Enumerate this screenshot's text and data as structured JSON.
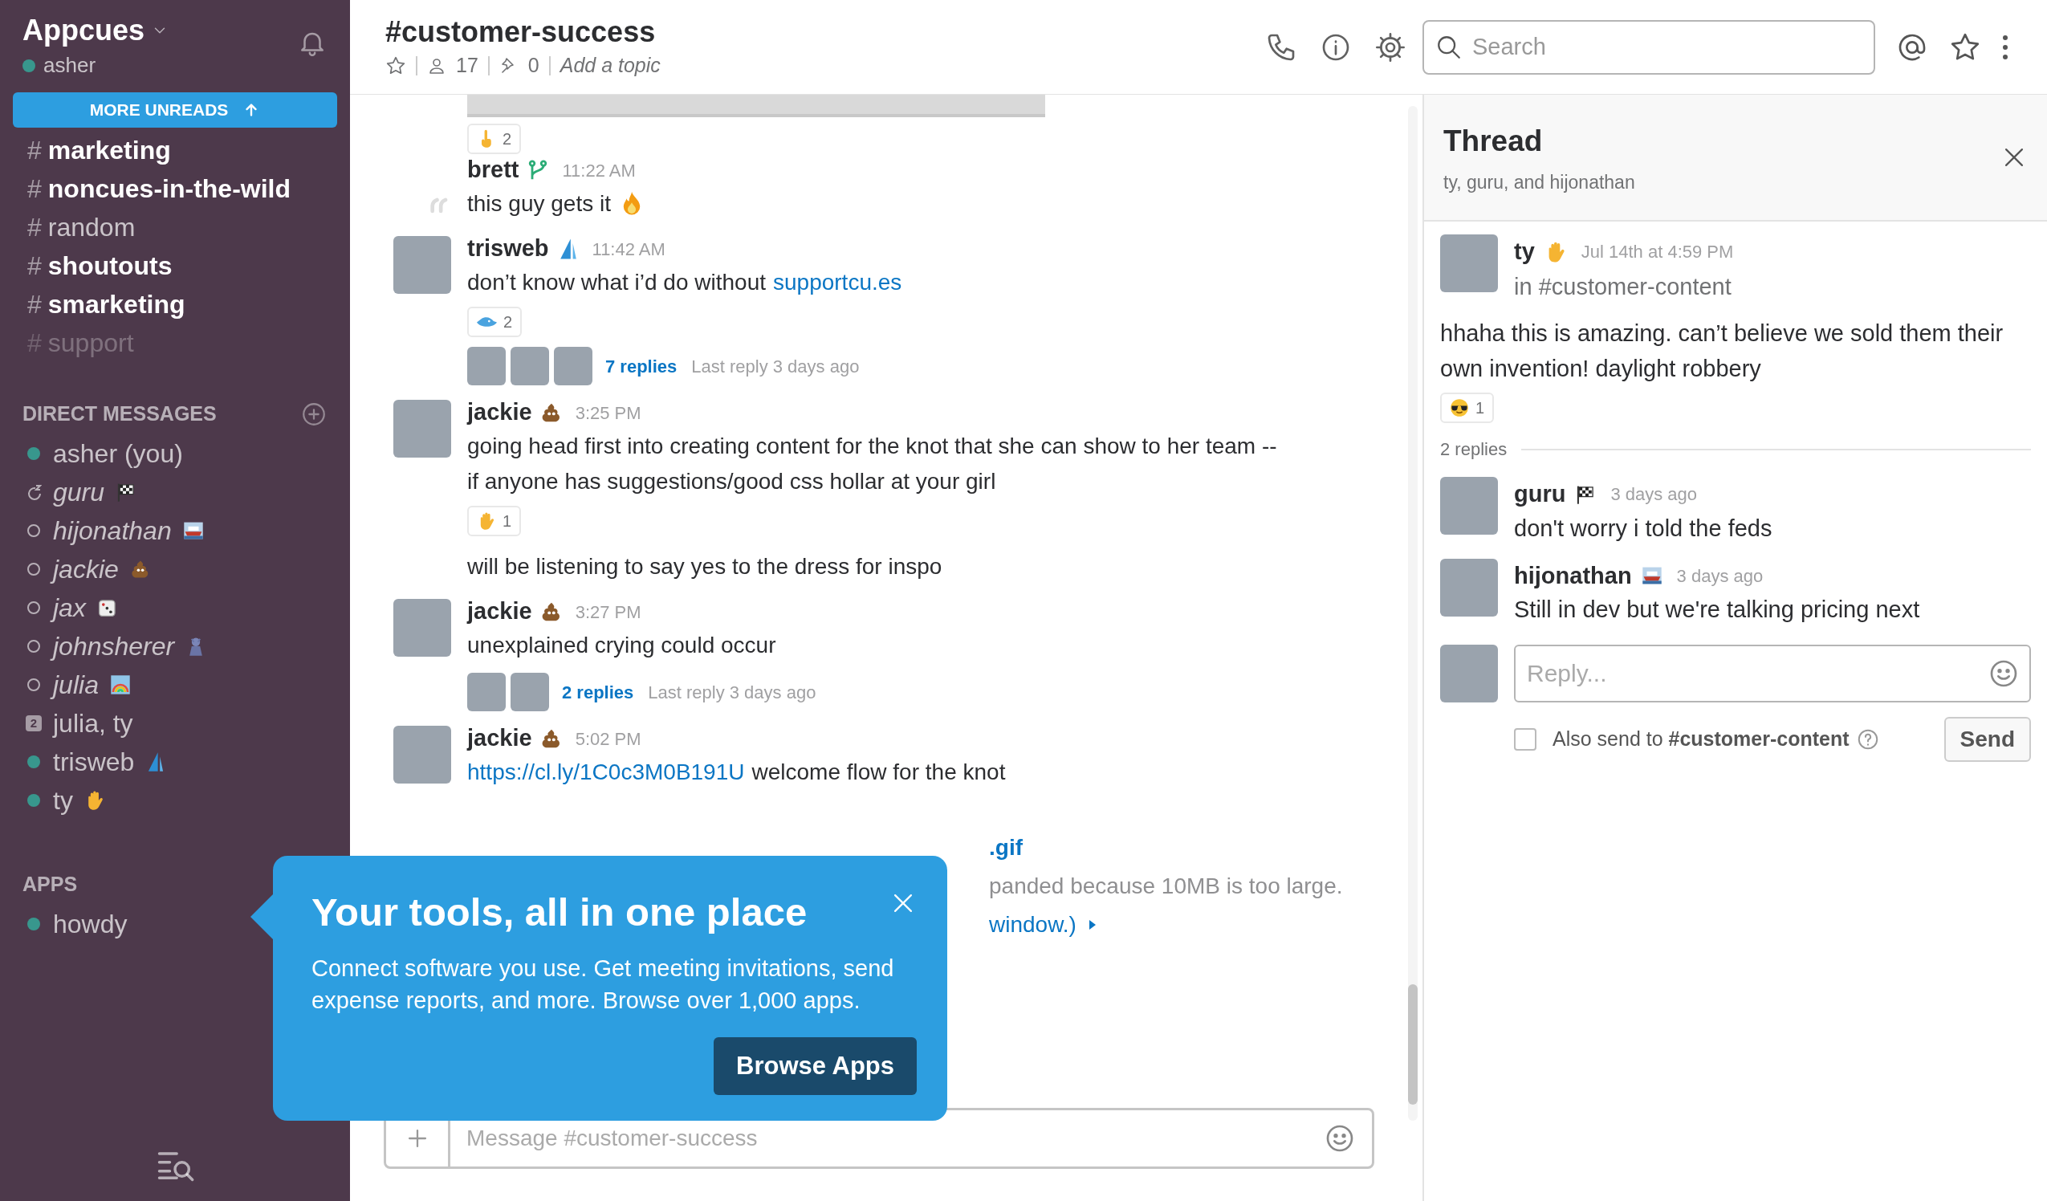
{
  "sidebar": {
    "team": "Appcues",
    "user": "asher",
    "user_online": true,
    "more_unreads": "MORE UNREADS",
    "channels": [
      {
        "prefix": "#",
        "name": "marketing",
        "unread": true,
        "muted": false
      },
      {
        "prefix": "#",
        "name": "noncues-in-the-wild",
        "unread": true,
        "muted": false
      },
      {
        "prefix": "#",
        "name": "random",
        "unread": false,
        "muted": false
      },
      {
        "prefix": "#",
        "name": "shoutouts",
        "unread": true,
        "muted": false
      },
      {
        "prefix": "#",
        "name": "smarketing",
        "unread": true,
        "muted": false
      },
      {
        "prefix": "#",
        "name": "support",
        "unread": false,
        "muted": true
      }
    ],
    "dm_header": "DIRECT MESSAGES",
    "direct_messages": [
      {
        "name": "asher (you)",
        "kind": "online"
      },
      {
        "name": "guru",
        "kind": "snoozed",
        "emoji": {
          "kind": "checkered-flag"
        }
      },
      {
        "name": "hijonathan",
        "kind": "away",
        "emoji": {
          "kind": "ship"
        }
      },
      {
        "name": "jackie",
        "kind": "away",
        "emoji": {
          "kind": "poop"
        }
      },
      {
        "name": "jax",
        "kind": "away",
        "emoji": {
          "kind": "die"
        }
      },
      {
        "name": "johnsherer",
        "kind": "away",
        "emoji": {
          "kind": "figure"
        }
      },
      {
        "name": "julia",
        "kind": "away",
        "emoji": {
          "kind": "rainbow"
        }
      },
      {
        "name": "julia, ty",
        "kind": "group",
        "badge": "2"
      },
      {
        "name": "trisweb",
        "kind": "online",
        "emoji": {
          "kind": "sail"
        }
      },
      {
        "name": "ty",
        "kind": "online",
        "emoji": {
          "kind": "hand"
        }
      }
    ],
    "apps_header": "APPS",
    "apps": [
      {
        "name": "howdy",
        "kind": "online"
      }
    ]
  },
  "channel_header": {
    "title": "#customer-success",
    "members": "17",
    "pins": "0",
    "topic_placeholder": "Add a topic",
    "search_placeholder": "Search"
  },
  "messages": [
    {
      "kind": "image",
      "reactions": [
        {
          "emoji": {
            "kind": "finger"
          },
          "count": "2"
        }
      ]
    },
    {
      "kind": "message",
      "author": "brett",
      "avatar": false,
      "emoji": {
        "kind": "branch"
      },
      "time": "11:22 AM",
      "lines": [
        [
          {
            "kind": "text",
            "text": "this guy gets it"
          },
          {
            "kind": "emoji",
            "emoji": {
              "kind": "fire"
            }
          }
        ]
      ]
    },
    {
      "kind": "message",
      "author": "trisweb",
      "avatar": true,
      "emoji": {
        "kind": "sail"
      },
      "time": "11:42 AM",
      "lines": [
        [
          {
            "kind": "text",
            "text": "don’t know what i’d do without"
          },
          {
            "kind": "link",
            "text": "supportcu.es"
          }
        ]
      ],
      "reactions": [
        {
          "emoji": {
            "kind": "boat"
          },
          "count": "2"
        }
      ],
      "thread": {
        "avatars": [
          {
            "kind": "photo"
          },
          {
            "kind": "photo"
          },
          {
            "kind": "photo"
          }
        ],
        "replies": "7 replies",
        "last": "Last reply 3 days ago"
      }
    },
    {
      "kind": "message",
      "author": "jackie",
      "avatar": true,
      "emoji": {
        "kind": "poop"
      },
      "time": "3:25 PM",
      "lines": [
        [
          {
            "kind": "text",
            "text": "going head first into creating content for the knot that she can show to her team --"
          }
        ],
        [
          {
            "kind": "text",
            "text": "if anyone has suggestions/good css hollar at your girl"
          }
        ]
      ],
      "reactions": [
        {
          "emoji": {
            "kind": "hand"
          },
          "count": "1"
        }
      ]
    },
    {
      "kind": "continuation",
      "lines": [
        [
          {
            "kind": "text",
            "text": "will be listening to say yes to the dress for inspo"
          }
        ]
      ]
    },
    {
      "kind": "message",
      "author": "jackie",
      "avatar": true,
      "emoji": {
        "kind": "poop"
      },
      "time": "3:27 PM",
      "lines": [
        [
          {
            "kind": "text",
            "text": "unexplained crying could occur"
          }
        ]
      ],
      "thread": {
        "avatars": [
          {
            "kind": "photo"
          },
          {
            "kind": "photo"
          }
        ],
        "replies": "2 replies",
        "last": "Last reply 3 days ago"
      }
    },
    {
      "kind": "message",
      "author": "jackie",
      "avatar": true,
      "emoji": {
        "kind": "poop"
      },
      "time": "5:02 PM",
      "lines": [
        [
          {
            "kind": "link",
            "text": "https://cl.ly/1C0c3M0B191U"
          },
          {
            "kind": "text",
            "text": "welcome flow for the knot"
          }
        ]
      ]
    },
    {
      "kind": "covered",
      "file": ".gif",
      "note": "panded because 10MB is too large.",
      "link": "window.)"
    }
  ],
  "composer": {
    "placeholder": "Message #customer-success"
  },
  "popup": {
    "title": "Your tools, all in one place",
    "body": "Connect software you use. Get meeting invitations, send expense reports, and more. Browse over 1,000 apps.",
    "button": "Browse Apps"
  },
  "thread": {
    "title": "Thread",
    "subtitle": "ty, guru, and hijonathan",
    "parent": {
      "author": "ty",
      "emoji": {
        "kind": "hand"
      },
      "time": "Jul 14th at 4:59 PM",
      "channel": "in #customer-content",
      "text": "hhaha this is amazing. can’t believe we sold them their own invention! daylight robbery",
      "reactions": [
        {
          "emoji": {
            "kind": "sunglasses"
          },
          "count": "1"
        }
      ]
    },
    "reply_count": "2 replies",
    "replies": [
      {
        "author": "guru",
        "emoji": {
          "kind": "checkered-flag"
        },
        "time": "3 days ago",
        "text": "don't worry i told the feds"
      },
      {
        "author": "hijonathan",
        "emoji": {
          "kind": "ship"
        },
        "time": "3 days ago",
        "text": "Still in dev but we're talking pricing next"
      }
    ],
    "reply_placeholder": "Reply...",
    "also_send": {
      "label": "Also send to **#customer-content**",
      "checked": false
    },
    "send": "Send"
  }
}
